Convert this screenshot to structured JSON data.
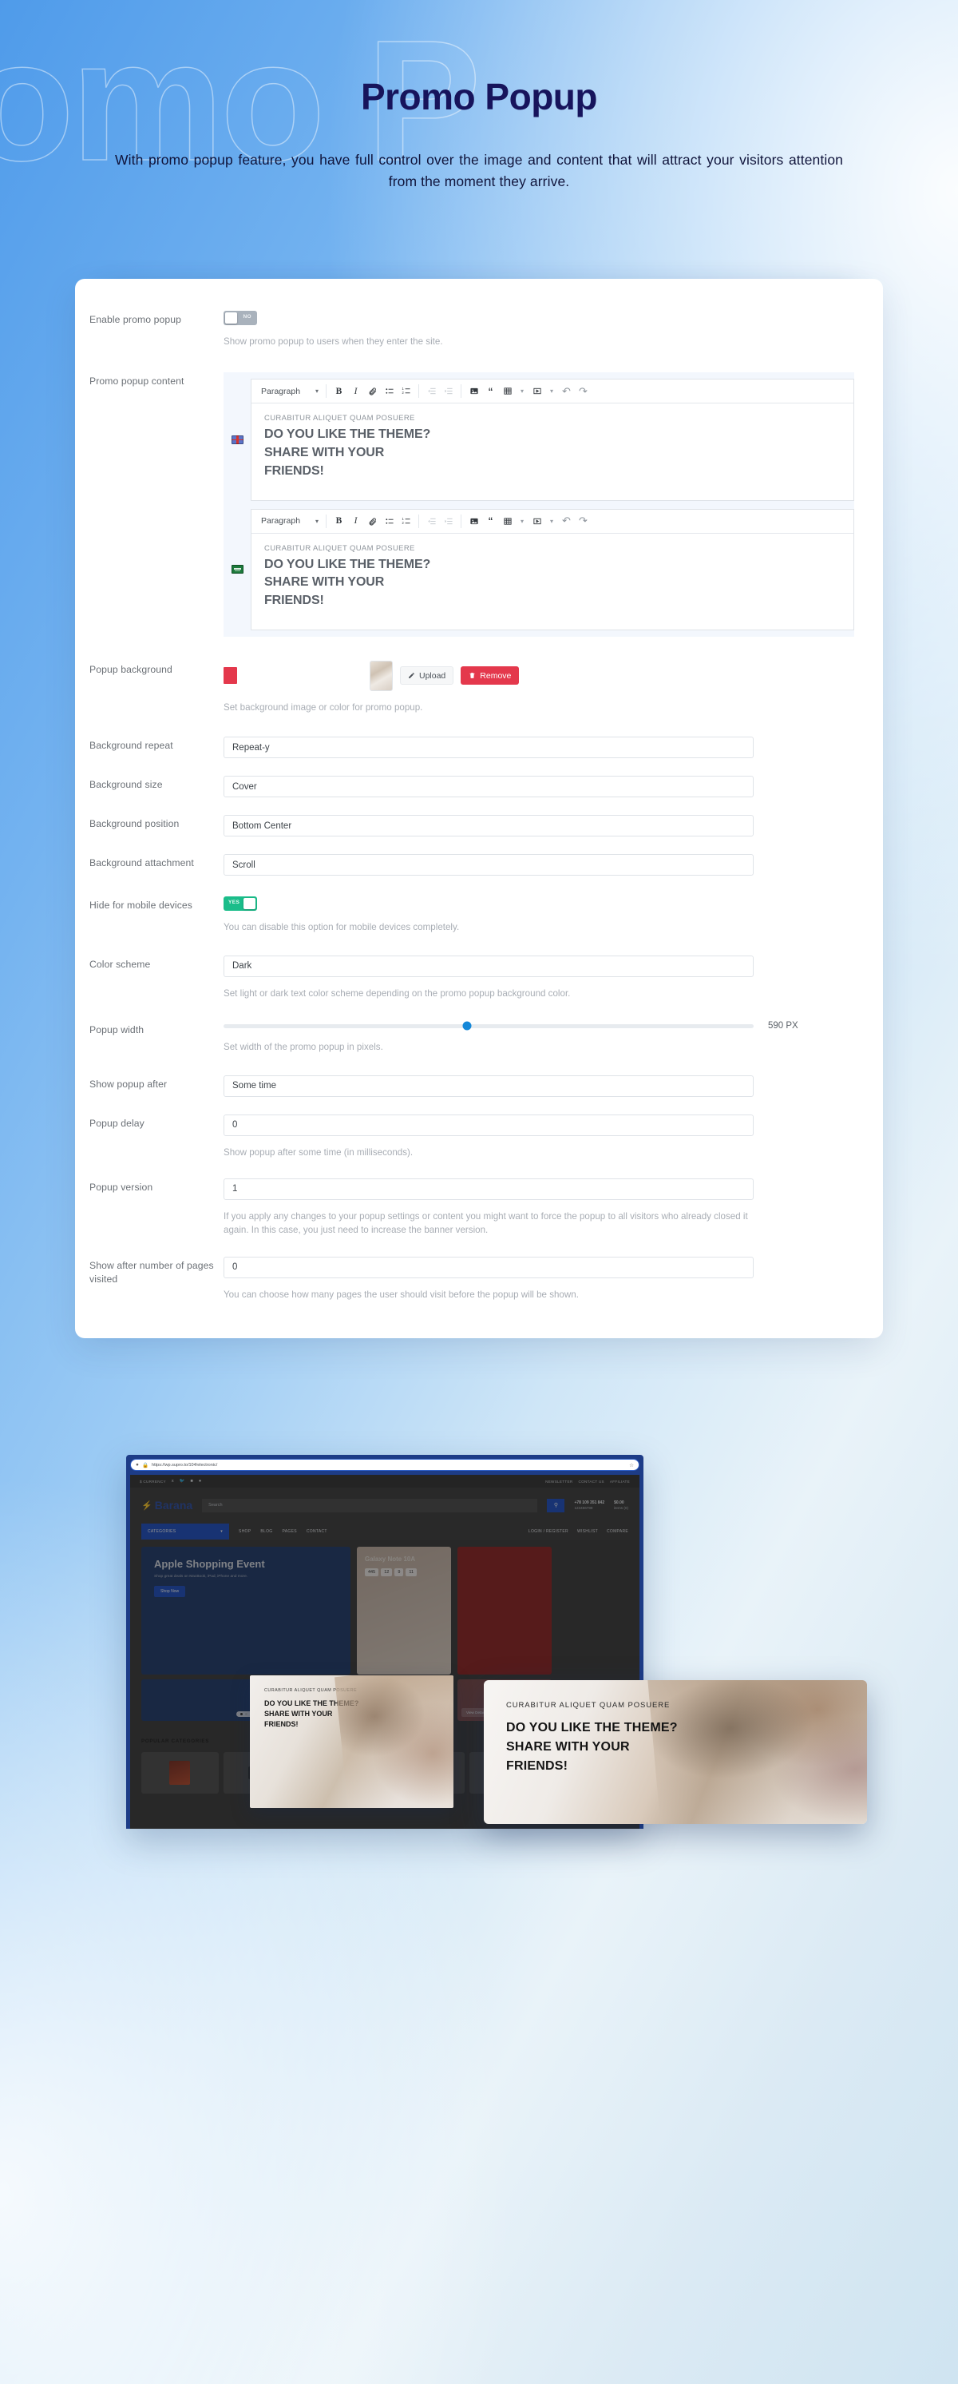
{
  "hero": {
    "watermark": "romo P",
    "title": "Promo Popup",
    "subtitle": "With promo popup feature, you have full control over the image and content that will attract your visitors attention from the moment they arrive."
  },
  "settings": {
    "enable": {
      "label": "Enable promo popup",
      "toggle_value": "NO",
      "helper": "Show promo popup to users when they enter the site."
    },
    "content": {
      "label": "Promo popup content",
      "editors": [
        {
          "flag": "uk-flag-icon",
          "format_select": "Paragraph",
          "kicker": "CURABITUR ALIQUET QUAM POSUERE",
          "line1": "DO YOU LIKE THE THEME?",
          "line2": "SHARE WITH YOUR",
          "line3": "FRIENDS!"
        },
        {
          "flag": "saudi-flag-icon",
          "format_select": "Paragraph",
          "kicker": "CURABITUR ALIQUET QUAM POSUERE",
          "line1": "DO YOU LIKE THE THEME?",
          "line2": "SHARE WITH YOUR",
          "line3": "FRIENDS!"
        }
      ],
      "toolbar": {
        "bold": "B",
        "italic": "I",
        "link": "link-icon",
        "bullet_list": "bullet-list-icon",
        "numbered_list": "numbered-list-icon",
        "outdent": "outdent-icon",
        "indent": "indent-icon",
        "image": "image-icon",
        "quote": "quote-icon",
        "table": "table-icon",
        "media": "media-icon",
        "undo": "undo-icon",
        "redo": "redo-icon"
      }
    },
    "background": {
      "label": "Popup background",
      "color_hex": "#e4384c",
      "upload_label": "Upload",
      "remove_label": "Remove",
      "helper": "Set background image or color for promo popup."
    },
    "bg_repeat": {
      "label": "Background repeat",
      "value": "Repeat-y"
    },
    "bg_size": {
      "label": "Background size",
      "value": "Cover"
    },
    "bg_position": {
      "label": "Background position",
      "value": "Bottom Center"
    },
    "bg_attachment": {
      "label": "Background attachment",
      "value": "Scroll"
    },
    "hide_mobile": {
      "label": "Hide for mobile devices",
      "toggle_value": "YES",
      "helper": "You can disable this option for mobile devices completely."
    },
    "color_scheme": {
      "label": "Color scheme",
      "value": "Dark",
      "helper": "Set light or dark text color scheme depending on the promo popup background color."
    },
    "popup_width": {
      "label": "Popup width",
      "value": "590 PX",
      "percent": 46,
      "helper": "Set width of the promo popup in pixels."
    },
    "show_after": {
      "label": "Show popup after",
      "value": "Some time"
    },
    "popup_delay": {
      "label": "Popup delay",
      "value": "0",
      "helper": "Show popup after some time (in milliseconds)."
    },
    "popup_version": {
      "label": "Popup version",
      "value": "1",
      "helper": "If you apply any changes to your popup settings or content you might want to force the popup to all visitors who already closed it again. In this case, you just need to increase the banner version."
    },
    "pages_visited": {
      "label": "Show after number of pages visited",
      "value": "0",
      "helper": "You can choose how many pages the user should visit before the popup will be shown."
    }
  },
  "mockup": {
    "url": "https://wp.supro.to/104/electronic/",
    "topbar": {
      "currency": "$ CURRENCY",
      "newsletter": "NEWSLETTER",
      "contact": "CONTACT US",
      "affiliate": "AFFILIATE"
    },
    "brand": "Barana",
    "search_placeholder": "Search",
    "phone": "+78 109 351 842",
    "phone_sub": "123456789",
    "cart_total": "$0.00",
    "cart_items": "items (0)",
    "nav": {
      "categories": "CATEGORIES",
      "links": [
        "SHOP",
        "BLOG",
        "PAGES",
        "CONTACT"
      ],
      "login": "LOGIN / REGISTER",
      "wishlist": "WISHLIST",
      "compare": "COMPARE"
    },
    "hero": {
      "title": "Apple Shopping Event",
      "subtitle": "Shop great deals on MacBook, iPad, iPhone and more.",
      "cta": "Shop Now"
    },
    "promo_card": {
      "title": "Galaxy Note 10A",
      "countdown": [
        "445",
        "12",
        "9",
        "11"
      ]
    },
    "view_details": "View Details",
    "popular_categories": "POPULAR CATEGORIES",
    "popup_small": {
      "kicker": "CURABITUR ALIQUET QUAM POSUERE",
      "line1": "DO YOU LIKE THE THEME?",
      "line2": "SHARE WITH YOUR",
      "line3": "FRIENDS!"
    },
    "popup_large": {
      "kicker": "CURABITUR ALIQUET QUAM POSUERE",
      "line1": "DO YOU LIKE THE THEME?",
      "line2": "SHARE WITH YOUR",
      "line3": "FRIENDS!"
    }
  }
}
